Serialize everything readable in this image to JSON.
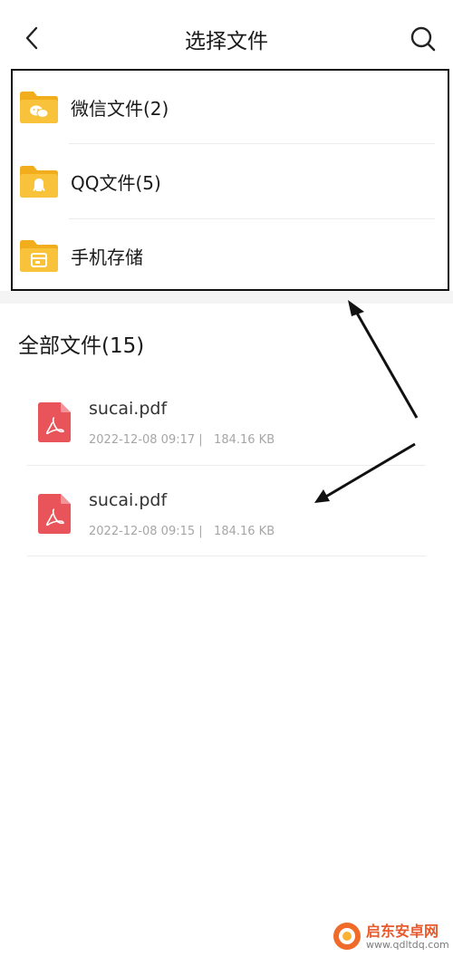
{
  "header": {
    "title": "选择文件",
    "back_icon": "chevron-left-icon",
    "search_icon": "search-icon"
  },
  "sources": [
    {
      "label": "微信文件(2)",
      "icon": "wechat-folder-icon"
    },
    {
      "label": "QQ文件(5)",
      "icon": "qq-folder-icon"
    },
    {
      "label": "手机存储",
      "icon": "phone-storage-folder-icon"
    }
  ],
  "section": {
    "title": "全部文件(15)"
  },
  "files": [
    {
      "name": "sucai.pdf",
      "meta": "2022-12-08 09:17 |   184.16 KB",
      "icon": "pdf-file-icon"
    },
    {
      "name": "sucai.pdf",
      "meta": "2022-12-08 09:15 |   184.16 KB",
      "icon": "pdf-file-icon"
    }
  ],
  "watermark": {
    "name": "启东安卓网",
    "url": "www.qdltdq.com"
  },
  "colors": {
    "folder": "#f8c23a",
    "folder_tab": "#f2ad1c",
    "pdf": "#e9545a",
    "divider": "#ececec",
    "meta_text": "#a6a6a6"
  }
}
